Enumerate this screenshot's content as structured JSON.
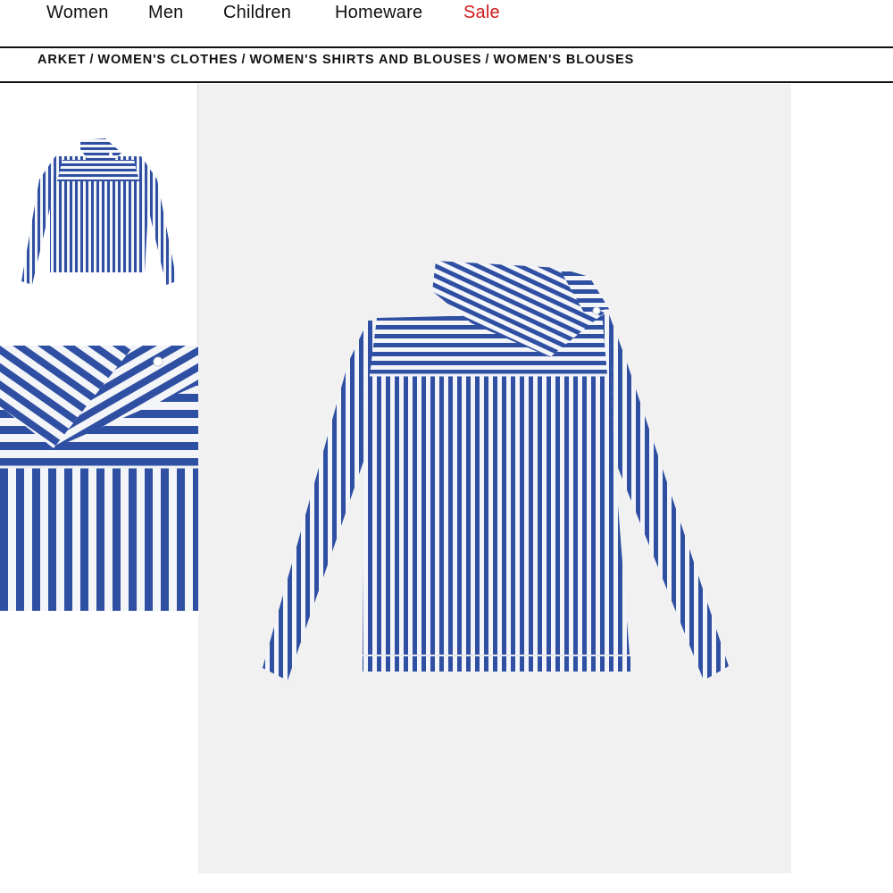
{
  "nav": {
    "items": [
      {
        "label": "Women"
      },
      {
        "label": "Men"
      },
      {
        "label": "Children"
      },
      {
        "label": "Homeware"
      },
      {
        "label": "Sale"
      }
    ]
  },
  "breadcrumb": {
    "items": [
      "ARKET",
      "WOMEN'S CLOTHES",
      "WOMEN'S SHIRTS AND BLOUSES",
      "WOMEN'S BLOUSES"
    ],
    "separator": "/"
  },
  "colors": {
    "sale": "#d11a1a",
    "stripe_blue": "#2f4fa3",
    "stripe_white": "#f4f5f8",
    "image_bg": "#f1f1f1"
  },
  "gallery": {
    "thumbnails": [
      {
        "icon": "striped-shirt-front-thumbnail"
      },
      {
        "icon": "striped-shirt-collar-detail-thumbnail"
      }
    ],
    "main_image": {
      "icon": "striped-shirt-main-image"
    }
  }
}
